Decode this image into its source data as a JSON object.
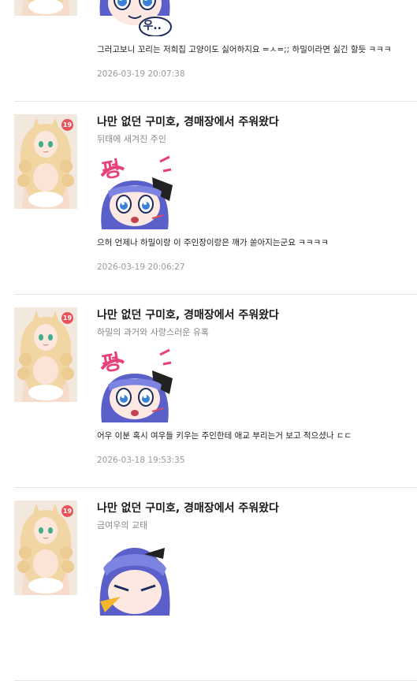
{
  "comments": [
    {
      "work_title": "",
      "chapter_title": "",
      "sticker": "surprised-maid-sticker",
      "sticker_text": "우..",
      "text": "그러고보니 꼬리는 저희집 고양이도 싫어하지요 =ㅅ=;; 하밀이라면 싫긴 할듯 ㅋㅋㅋ",
      "timestamp": "2026-03-19 20:07:38",
      "age_badge": "19"
    },
    {
      "work_title": "나만 없던 구미호, 경매장에서 주워왔다",
      "chapter_title": "뒤태에 새겨진 주인",
      "sticker": "shocked-maid-sticker",
      "sticker_text": "펑",
      "text": "으허 언제나 하밀이랑 이 주인장이랑은 깨가 쏟아지는군요 ㅋㅋㅋㅋ",
      "timestamp": "2026-03-19 20:06:27",
      "age_badge": "19"
    },
    {
      "work_title": "나만 없던 구미호, 경매장에서 주워왔다",
      "chapter_title": "하밀의 과거와 사랑스러운 유혹",
      "sticker": "shocked-maid-sticker",
      "sticker_text": "펑",
      "text": "어우 이분 혹시 여우들 키우는 주인한테 애교 부리는거 보고 적으셨나 ㄷㄷ",
      "timestamp": "2026-03-18 19:53:35",
      "age_badge": "19"
    },
    {
      "work_title": "나만 없던 구미호, 경매장에서 주워왔다",
      "chapter_title": "금여우의 교태",
      "sticker": "angry-maid-sticker",
      "sticker_text": "",
      "text": "",
      "timestamp": "",
      "age_badge": "19"
    }
  ],
  "colors": {
    "badge": "#e8525a",
    "title": "#1a1a1a",
    "meta": "#888888",
    "timestamp": "#999999",
    "divider": "#e5e5e5",
    "sticker_pink": "#e8407a",
    "sticker_hair": "#5b5fc9"
  }
}
